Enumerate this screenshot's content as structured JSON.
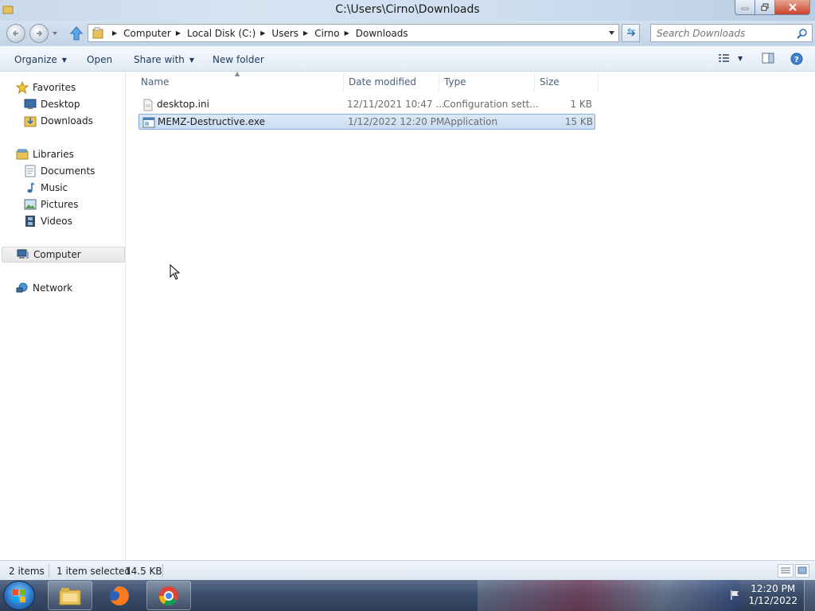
{
  "window": {
    "title": "C:\\Users\\Cirno\\Downloads"
  },
  "address": {
    "crumbs": [
      "Computer",
      "Local Disk (C:)",
      "Users",
      "Cirno",
      "Downloads"
    ],
    "search_placeholder": "Search Downloads"
  },
  "toolbar": {
    "organize_label": "Organize",
    "open_label": "Open",
    "share_label": "Share with",
    "new_folder_label": "New folder"
  },
  "nav": {
    "favorites": "Favorites",
    "favorites_items": [
      "Desktop",
      "Downloads"
    ],
    "libraries": "Libraries",
    "libraries_items": [
      "Documents",
      "Music",
      "Pictures",
      "Videos"
    ],
    "computer": "Computer",
    "network": "Network"
  },
  "columns": {
    "name": "Name",
    "date": "Date modified",
    "type": "Type",
    "size": "Size"
  },
  "files": [
    {
      "name": "desktop.ini",
      "date": "12/11/2021 10:47 ...",
      "type": "Configuration sett...",
      "size": "1 KB",
      "icon": "ini-file-icon",
      "selected": false
    },
    {
      "name": "MEMZ-Destructive.exe",
      "date": "1/12/2022 12:20 PM",
      "type": "Application",
      "size": "15 KB",
      "icon": "exe-file-icon",
      "selected": true
    }
  ],
  "status": {
    "item_count": "2 items",
    "selected": "1 item selected",
    "selected_size": "14.5 KB"
  },
  "clock": {
    "time": "12:20 PM",
    "date": "1/12/2022"
  },
  "colors": {
    "selection": "#c9ddf3",
    "selection_border": "#84acdd",
    "link_text": "#1e395b"
  }
}
